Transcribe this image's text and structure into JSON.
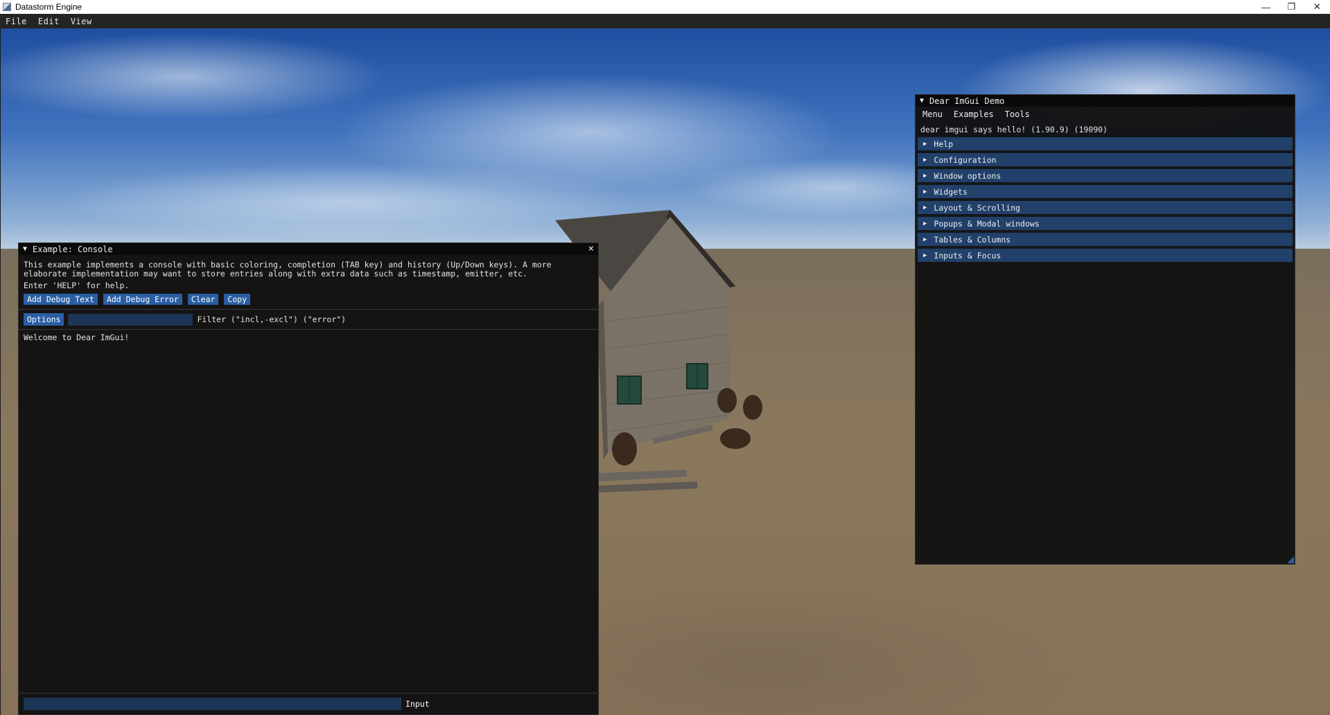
{
  "window": {
    "title": "Datastorm Engine",
    "controls": [
      "minimize-icon",
      "restore-icon",
      "close-icon"
    ]
  },
  "menubar": {
    "items": [
      "File",
      "Edit",
      "View"
    ]
  },
  "console": {
    "title": "Example: Console",
    "description_line1": "This example implements a console with basic coloring, completion (TAB key) and history (Up/Down keys). A more",
    "description_line2": "elaborate implementation may want to store entries along with extra data such as timestamp, emitter, etc.",
    "help_hint": "Enter 'HELP' for help.",
    "buttons": [
      "Add Debug Text",
      "Add Debug Error",
      "Clear",
      "Copy"
    ],
    "options_label": "Options",
    "filter_value": "",
    "filter_label": "Filter (\"incl,-excl\") (\"error\")",
    "log": [
      "Welcome to Dear ImGui!"
    ],
    "input_value": "",
    "input_label": "Input"
  },
  "demo": {
    "title": "Dear ImGui Demo",
    "menu": [
      "Menu",
      "Examples",
      "Tools"
    ],
    "hello": "dear imgui says hello! (1.90.9) (19090)",
    "sections": [
      "Help",
      "Configuration",
      "Window options",
      "Widgets",
      "Layout & Scrolling",
      "Popups & Modal windows",
      "Tables & Columns",
      "Inputs & Focus"
    ]
  },
  "colors": {
    "imgui_button": "#2a5ea3",
    "imgui_header": "#21406a",
    "imgui_window_bg": "#111111",
    "imgui_title_bg": "#0a0a0a"
  }
}
